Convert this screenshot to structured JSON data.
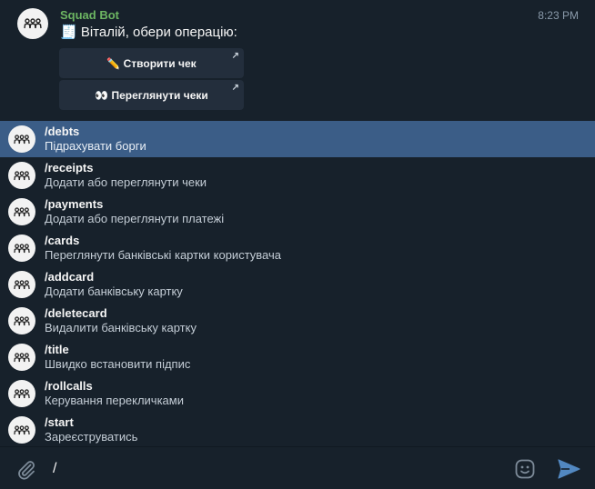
{
  "message": {
    "sender": "Squad Bot",
    "time": "8:23 PM",
    "text": "🧾 Віталій, обери операцію:",
    "buttons": [
      {
        "label": "✏️ Створити чек",
        "arrow": "↗"
      },
      {
        "label": "👀 Переглянути чеки",
        "arrow": "↗"
      }
    ]
  },
  "commands": [
    {
      "name": "/debts",
      "description": "Підрахувати борги",
      "active": true
    },
    {
      "name": "/receipts",
      "description": "Додати або переглянути чеки",
      "active": false
    },
    {
      "name": "/payments",
      "description": "Додати або переглянути платежі",
      "active": false
    },
    {
      "name": "/cards",
      "description": "Переглянути банківські картки користувача",
      "active": false
    },
    {
      "name": "/addcard",
      "description": "Додати банківську картку",
      "active": false
    },
    {
      "name": "/deletecard",
      "description": "Видалити банківську картку",
      "active": false
    },
    {
      "name": "/title",
      "description": "Швидко встановити підпис",
      "active": false
    },
    {
      "name": "/rollcalls",
      "description": "Керування перекличками",
      "active": false
    },
    {
      "name": "/start",
      "description": "Зареєструватись",
      "active": false
    }
  ],
  "composer": {
    "input_value": "/",
    "icons": [
      "paperclip-icon",
      "emoji-icon",
      "send-icon"
    ]
  },
  "colors": {
    "background": "#17212b",
    "sender": "#6cb562",
    "highlight": "#3b5d87",
    "send": "#5288c1"
  }
}
